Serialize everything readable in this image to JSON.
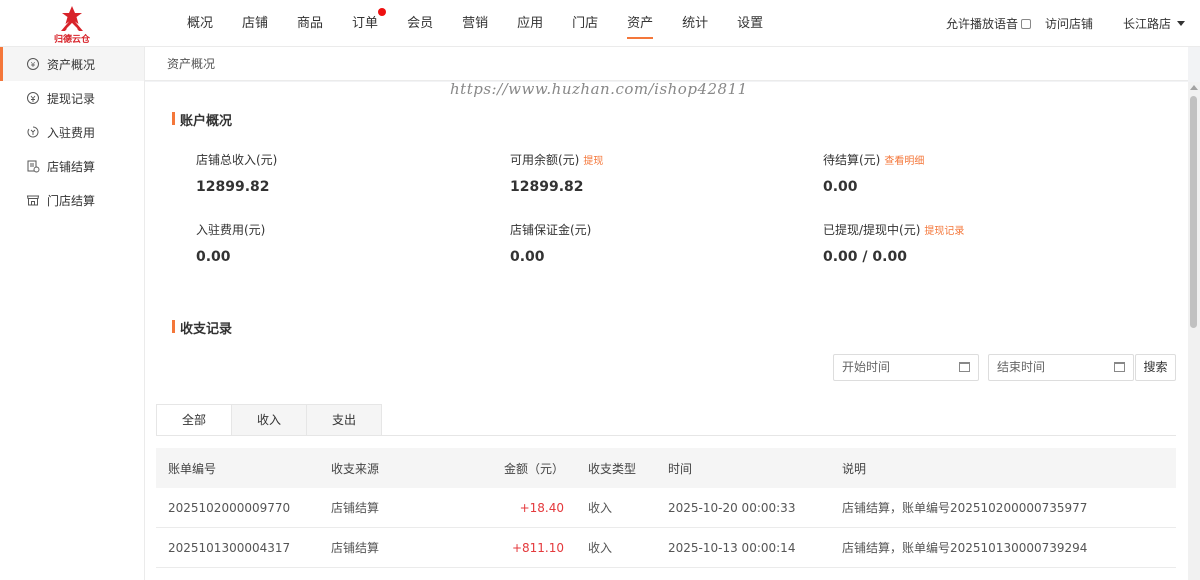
{
  "brand": {
    "logo_text": "归德云仓",
    "color": "#d8232a"
  },
  "nav": {
    "items": [
      {
        "label": "概况"
      },
      {
        "label": "店铺"
      },
      {
        "label": "商品"
      },
      {
        "label": "订单"
      },
      {
        "label": "会员"
      },
      {
        "label": "营销"
      },
      {
        "label": "应用"
      },
      {
        "label": "门店"
      },
      {
        "label": "资产"
      },
      {
        "label": "统计"
      },
      {
        "label": "设置"
      }
    ],
    "active": "资产",
    "badge_on": "订单"
  },
  "top_right": {
    "voice_label": "允许播放语音",
    "visit_store": "访问店铺",
    "store_name": "长江路店"
  },
  "sidebar": {
    "items": [
      {
        "label": "资产概况",
        "icon": "yen-circle-icon"
      },
      {
        "label": "提现记录",
        "icon": "withdraw-icon"
      },
      {
        "label": "入驻费用",
        "icon": "fee-icon"
      },
      {
        "label": "店铺结算",
        "icon": "settlement-icon"
      },
      {
        "label": "门店结算",
        "icon": "store-icon"
      }
    ]
  },
  "breadcrumb": "资产概况",
  "watermark": "https://www.huzhan.com/ishop42811",
  "account": {
    "title": "账户概况",
    "stats": [
      {
        "label": "店铺总收入(元)",
        "value": "12899.82",
        "link": ""
      },
      {
        "label": "可用余额(元)",
        "value": "12899.82",
        "link": "提现"
      },
      {
        "label": "待结算(元)",
        "value": "0.00",
        "link": "查看明细"
      },
      {
        "label": "入驻费用(元)",
        "value": "0.00",
        "link": ""
      },
      {
        "label": "店铺保证金(元)",
        "value": "0.00",
        "link": ""
      },
      {
        "label": "已提现/提现中(元)",
        "value": "0.00 / 0.00",
        "link": "提现记录"
      }
    ]
  },
  "records": {
    "title": "收支记录",
    "start_placeholder": "开始时间",
    "end_placeholder": "结束时间",
    "search_label": "搜索",
    "tabs": [
      {
        "label": "全部"
      },
      {
        "label": "收入"
      },
      {
        "label": "支出"
      }
    ],
    "columns": [
      "账单编号",
      "收支来源",
      "金额（元）",
      "收支类型",
      "时间",
      "说明"
    ],
    "rows": [
      [
        "2025102000009770",
        "店铺结算",
        "+18.40",
        "收入",
        "2025-10-20 00:00:33",
        "店铺结算，账单编号202510200000735977"
      ],
      [
        "2025101300004317",
        "店铺结算",
        "+811.10",
        "收入",
        "2025-10-13 00:00:14",
        "店铺结算，账单编号202510130000739294"
      ]
    ]
  },
  "colors": {
    "accent": "#f4773a",
    "positive": "#e4393c"
  }
}
